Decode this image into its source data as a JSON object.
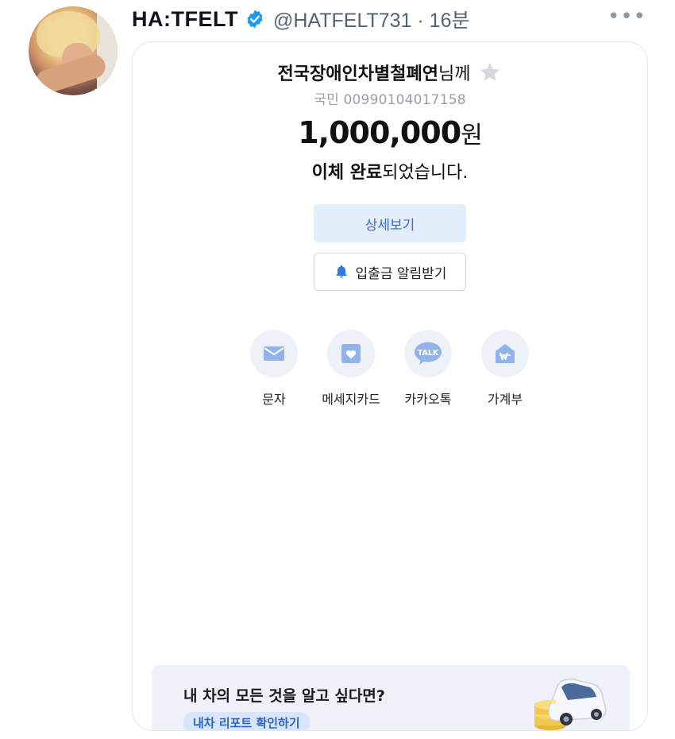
{
  "tweet": {
    "display_name": "HA:TFELT",
    "handle_time": "@HATFELT731 · 16분",
    "more_icon": "more-horizontal-icon",
    "verified_icon": "verified-badge-icon"
  },
  "transfer": {
    "recipient_bold": "전국장애인차별철폐연",
    "recipient_suffix": "님께",
    "account": "국민 00990104017158",
    "amount_number": "1,000,000",
    "amount_unit": "원",
    "done_bold": "이체 완료",
    "done_rest": "되었습니다.",
    "detail_button": "상세보기",
    "alert_button": "입출금 알림받기"
  },
  "share": [
    {
      "label": "문자",
      "icon": "envelope-icon"
    },
    {
      "label": "메세지카드",
      "icon": "heart-card-icon"
    },
    {
      "label": "카카오톡",
      "icon": "kakaotalk-icon",
      "icon_text": "TALK"
    },
    {
      "label": "가계부",
      "icon": "house-ledger-icon"
    }
  ],
  "banner": {
    "title": "내 차의 모든 것을 알고 싶다면?",
    "chip": "내차 리포트 확인하기"
  },
  "colors": {
    "accent_blue": "#3a6bc9",
    "icon_blue": "#8fb3ea",
    "verified_blue": "#1d9bf0"
  }
}
